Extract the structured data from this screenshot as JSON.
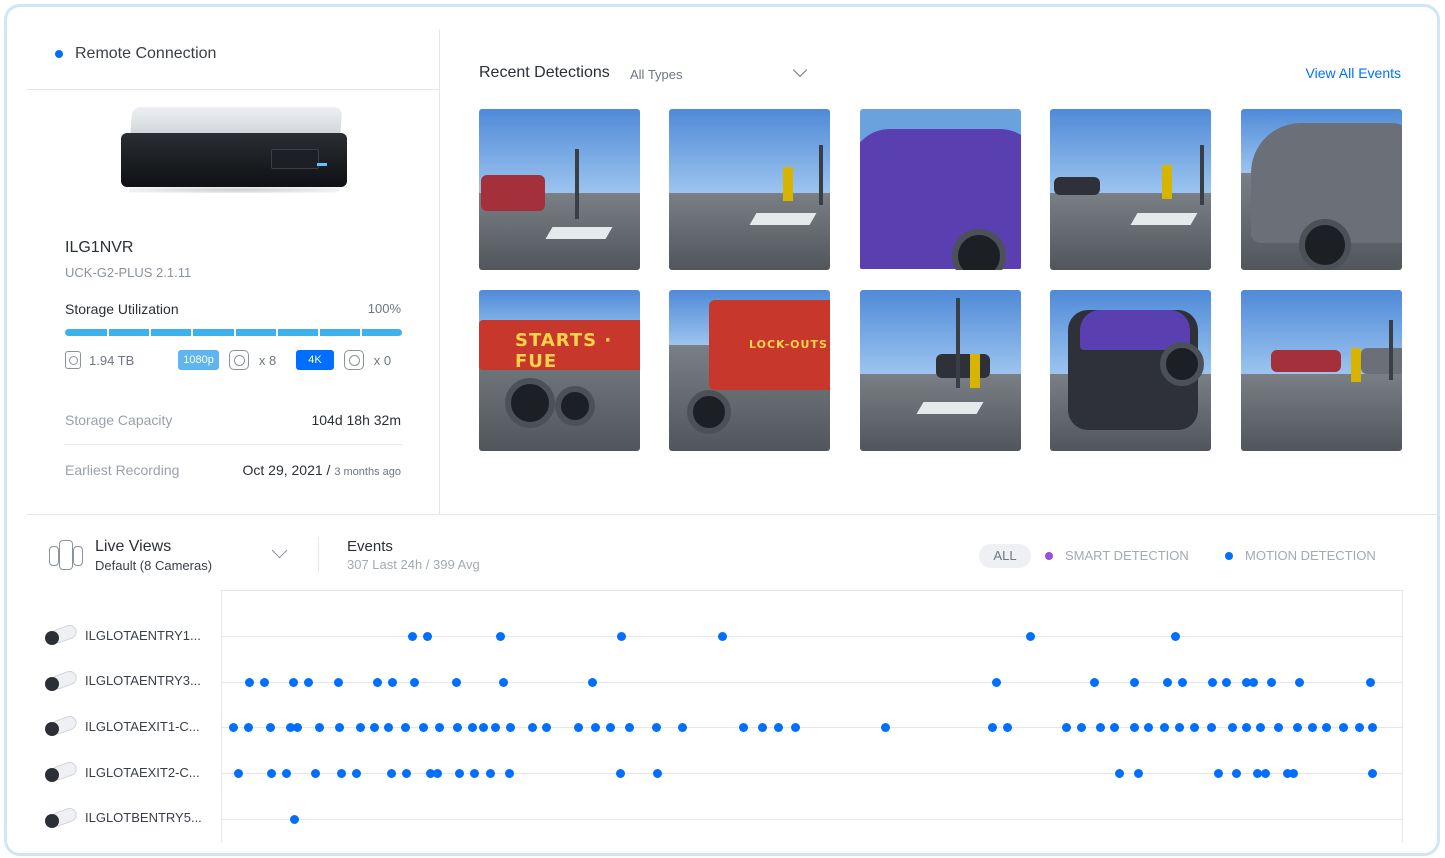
{
  "device": {
    "connection": "Remote Connection",
    "name": "ILG1NVR",
    "model": "UCK-G2-PLUS 2.1.11",
    "storage_label": "Storage Utilization",
    "storage_value": "100%",
    "storage_fraction": 1.0,
    "disk_size": "1.94 TB",
    "res_1080": "1080p",
    "res_1080_count": "x 8",
    "res_4k": "4K",
    "res_4k_count": "x 0",
    "capacity_label": "Storage Capacity",
    "capacity_value": "104d 18h 32m",
    "earliest_label": "Earliest Recording",
    "earliest_date": "Oct 29, 2021 / ",
    "earliest_ago": "3 months ago"
  },
  "detections": {
    "title": "Recent Detections",
    "filter": "All Types",
    "view_all": "View All Events",
    "thumb_texts": [
      "STARTS · FUE",
      "LOCK-OUTS"
    ]
  },
  "live_views": {
    "title": "Live Views",
    "subtitle": "Default (8 Cameras)"
  },
  "events": {
    "title": "Events",
    "subtitle": "307 Last 24h / 399 Avg",
    "filter_all": "ALL",
    "smart_label": "SMART DETECTION",
    "motion_label": "MOTION DETECTION",
    "colors": {
      "smart": "#9b4fe0",
      "motion": "#006fff"
    },
    "cameras": [
      {
        "name": "ILGLOTAENTRY1...",
        "events": [
          0.155,
          0.168,
          0.23,
          0.332,
          0.418,
          0.679,
          0.802
        ]
      },
      {
        "name": "ILGLOTAENTRY3...",
        "events": [
          0.017,
          0.03,
          0.054,
          0.067,
          0.092,
          0.125,
          0.138,
          0.157,
          0.192,
          0.232,
          0.308,
          0.65,
          0.733,
          0.767,
          0.795,
          0.808,
          0.833,
          0.845,
          0.862,
          0.868,
          0.883,
          0.907,
          0.967
        ]
      },
      {
        "name": "ILGLOTAEXIT1-C...",
        "events": [
          0.003,
          0.016,
          0.035,
          0.052,
          0.058,
          0.076,
          0.093,
          0.111,
          0.123,
          0.135,
          0.149,
          0.164,
          0.178,
          0.193,
          0.206,
          0.215,
          0.225,
          0.238,
          0.257,
          0.269,
          0.296,
          0.31,
          0.323,
          0.339,
          0.362,
          0.384,
          0.436,
          0.452,
          0.465,
          0.48,
          0.556,
          0.647,
          0.659,
          0.709,
          0.722,
          0.738,
          0.75,
          0.767,
          0.779,
          0.792,
          0.805,
          0.818,
          0.832,
          0.85,
          0.862,
          0.874,
          0.889,
          0.905,
          0.918,
          0.93,
          0.944,
          0.958,
          0.969
        ]
      },
      {
        "name": "ILGLOTAEXIT2-C...",
        "events": [
          0.008,
          0.036,
          0.048,
          0.073,
          0.095,
          0.108,
          0.137,
          0.15,
          0.17,
          0.176,
          0.195,
          0.208,
          0.221,
          0.237,
          0.331,
          0.363,
          0.754,
          0.77,
          0.838,
          0.853,
          0.871,
          0.878,
          0.897,
          0.902,
          0.969
        ]
      },
      {
        "name": "ILGLOTBENTRY5...",
        "events": [
          0.055
        ]
      }
    ]
  }
}
